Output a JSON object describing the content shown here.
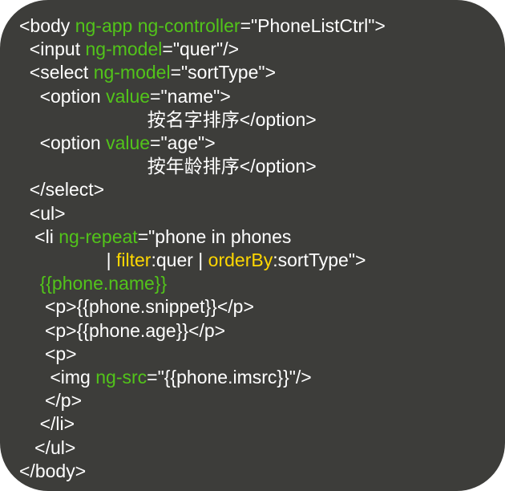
{
  "code": {
    "line1": {
      "open": "<body ",
      "attr1": "ng-app",
      "space1": " ",
      "attr2": "ng-controller",
      "eq": "=",
      "val": "\"PhoneListCtrl\"",
      "close": ">"
    },
    "line2": {
      "indent": "  ",
      "open": "<input ",
      "attr": "ng-model",
      "eq": "=",
      "val": "\"quer\"",
      "close": "/>"
    },
    "line3": {
      "indent": "  ",
      "open": "<select ",
      "attr": "ng-model",
      "eq": "=",
      "val": "\"sortType\"",
      "close": ">"
    },
    "line4": {
      "indent": "    ",
      "open": "<option ",
      "attr": "value",
      "eq": "=",
      "val": "\"name\"",
      "close": ">"
    },
    "line5": {
      "indent": "                         ",
      "text": "按名字排序</option>"
    },
    "line6": {
      "indent": "    ",
      "open": "<option ",
      "attr": "value",
      "eq": "=",
      "val": "\"age\"",
      "close": ">"
    },
    "line7": {
      "indent": "                         ",
      "text": "按年龄排序</option>"
    },
    "line8": {
      "indent": "  ",
      "text": "</select>"
    },
    "line9": {
      "indent": "  ",
      "text": "<ul>"
    },
    "line10": {
      "indent": "   ",
      "open": "<li ",
      "attr": "ng-repeat",
      "eq": "=",
      "val": "\"phone in phones"
    },
    "line11": {
      "indent": "                 ",
      "pipe1": "| ",
      "filter1": "filter",
      "mid1": ":quer ",
      "pipe2": "| ",
      "filter2": "orderBy",
      "mid2": ":sortType\"",
      "close": ">"
    },
    "line12": {
      "indent": "    ",
      "binding": "{{phone.name}}"
    },
    "line13": {
      "indent": "     ",
      "text": "<p>{{phone.snippet}}</p>"
    },
    "line14": {
      "indent": "     ",
      "text": "<p>{{phone.age}}</p>"
    },
    "line15": {
      "indent": "     ",
      "text": "<p>"
    },
    "line16": {
      "indent": "      ",
      "open": "<img ",
      "attr": "ng-src",
      "eq": "=",
      "val": "\"{{phone.imsrc}}\"",
      "close": "/>"
    },
    "line17": {
      "indent": "     ",
      "text": "</p>"
    },
    "line18": {
      "indent": "    ",
      "text": "</li>"
    },
    "line19": {
      "indent": "   ",
      "text": "</ul>"
    },
    "line20": {
      "text": "</body>"
    }
  }
}
